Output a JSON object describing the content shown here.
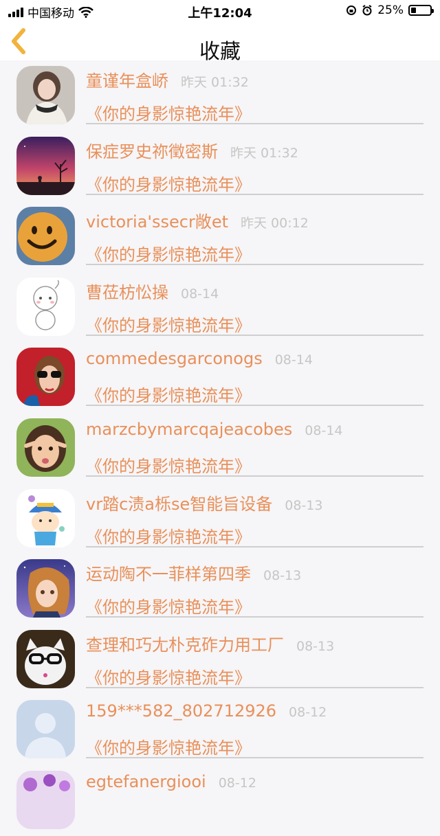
{
  "status_bar": {
    "carrier": "中国移动",
    "time": "上午12:04",
    "battery": "25%"
  },
  "nav": {
    "title": "收藏",
    "back_icon": "chevron-left-icon",
    "accent": "#f2b33d"
  },
  "colors": {
    "name": "#e8905a",
    "time": "#c6c6c6",
    "divider": "#cfcfcf"
  },
  "favorites": [
    {
      "name": "童谨年盒峤",
      "time": "昨天 01:32",
      "book": "《你的身影惊艳流年》"
    },
    {
      "name": "保症罗史祢徵密斯",
      "time": "昨天 01:32",
      "book": "《你的身影惊艳流年》"
    },
    {
      "name": "victoria'ssecr敞et",
      "time": "昨天 00:12",
      "book": "《你的身影惊艳流年》"
    },
    {
      "name": "曹莅枋忪操",
      "time": "08-14",
      "book": "《你的身影惊艳流年》"
    },
    {
      "name": "commedesgarconogs",
      "time": "08-14",
      "book": "《你的身影惊艳流年》"
    },
    {
      "name": "marzcbymarcqajeacobes",
      "time": "08-14",
      "book": "《你的身影惊艳流年》"
    },
    {
      "name": "vr踏c渍a栎se智能旨设备",
      "time": "08-13",
      "book": "《你的身影惊艳流年》"
    },
    {
      "name": "运动陶不一菲样第四季",
      "time": "08-13",
      "book": "《你的身影惊艳流年》"
    },
    {
      "name": "查理和巧尢朴克砟力用工厂",
      "time": "08-13",
      "book": "《你的身影惊艳流年》"
    },
    {
      "name": "159***582_802712926",
      "time": "08-12",
      "book": "《你的身影惊艳流年》"
    },
    {
      "name": "egtefanergiooi",
      "time": "08-12",
      "book": ""
    }
  ]
}
